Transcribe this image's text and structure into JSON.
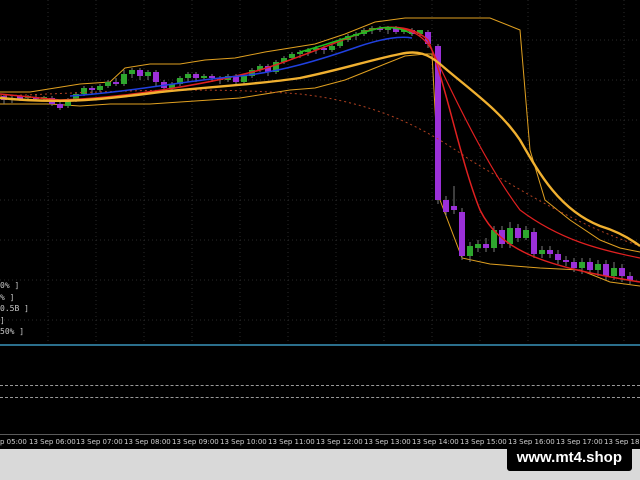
{
  "colors": {
    "background": "#000000",
    "bull_candle": "#2ea62e",
    "bear_candle": "#9b30d8",
    "envelope_line": "#e0a020",
    "slow_ma": "#f0b030",
    "fast_ma_red": "#e02020",
    "fast_ma_green": "#20c020",
    "fast_ma_blue": "#2040e0",
    "dotted_ma": "#b04020",
    "separator": "#2b6f8c"
  },
  "indicator_labels": [
    "0% ]",
    "% ]",
    "0.5B ]",
    "]",
    "50% ]"
  ],
  "time_axis": {
    "labels": [
      "p 05:00",
      "13 Sep 06:00",
      "13 Sep 07:00",
      "13 Sep 08:00",
      "13 Sep 09:00",
      "13 Sep 10:00",
      "13 Sep 11:00",
      "13 Sep 12:00",
      "13 Sep 13:00",
      "13 Sep 14:00",
      "13 Sep 15:00",
      "13 Sep 16:00",
      "13 Sep 17:00",
      "13 Sep 18:"
    ]
  },
  "watermark": "www.mt4.shop"
}
